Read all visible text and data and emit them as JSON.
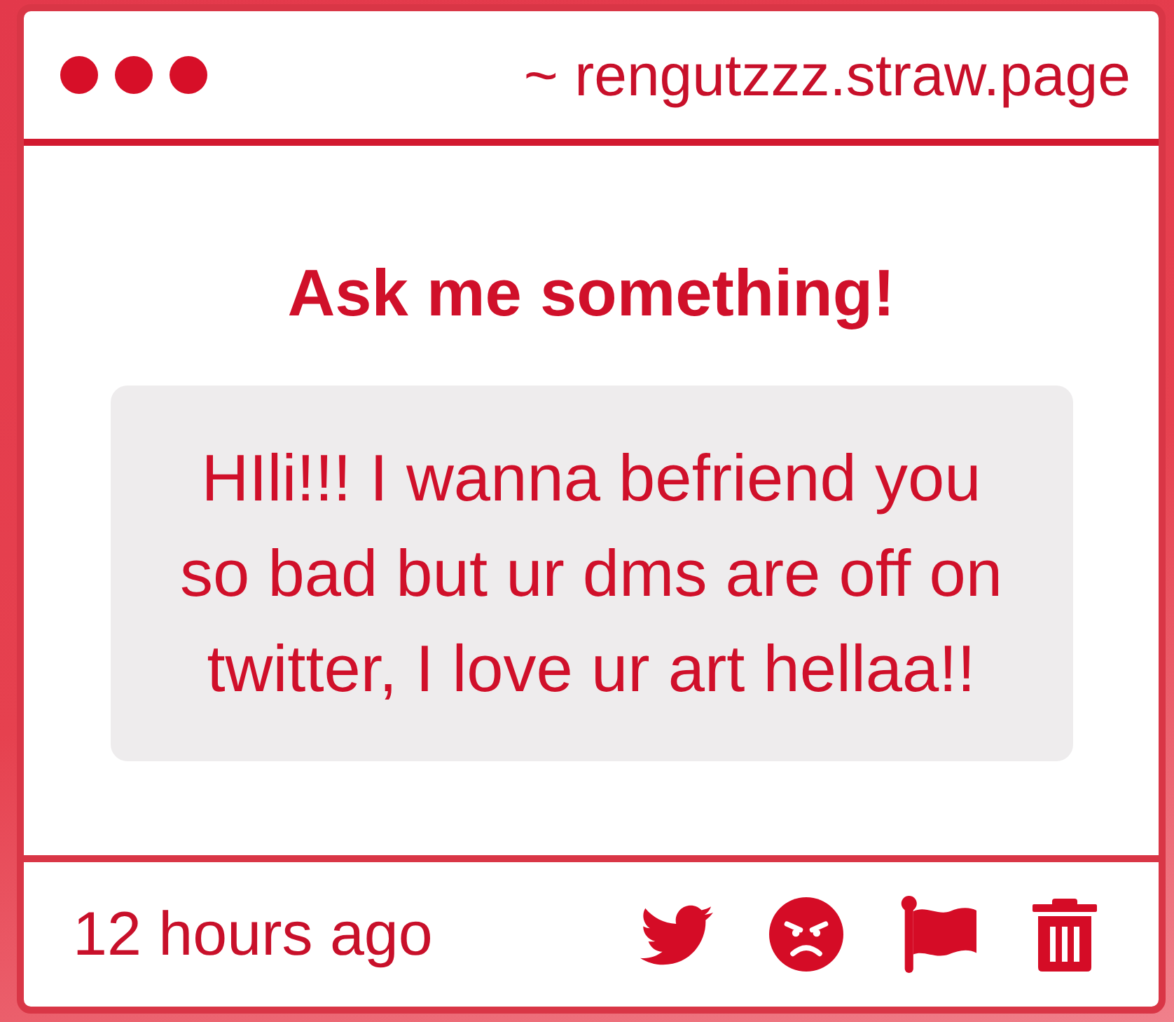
{
  "window": {
    "url": "~ rengutzzz.straw.page"
  },
  "question": {
    "title": "Ask me something!",
    "message": "HIli!!! I wanna befriend you so bad but ur dms are off on twitter, I love ur art hellaa!!"
  },
  "footer": {
    "timestamp": "12 hours ago",
    "actions": [
      {
        "kind": "bird"
      },
      {
        "kind": "angry_face"
      },
      {
        "kind": "flag"
      },
      {
        "kind": "trash"
      }
    ]
  }
}
